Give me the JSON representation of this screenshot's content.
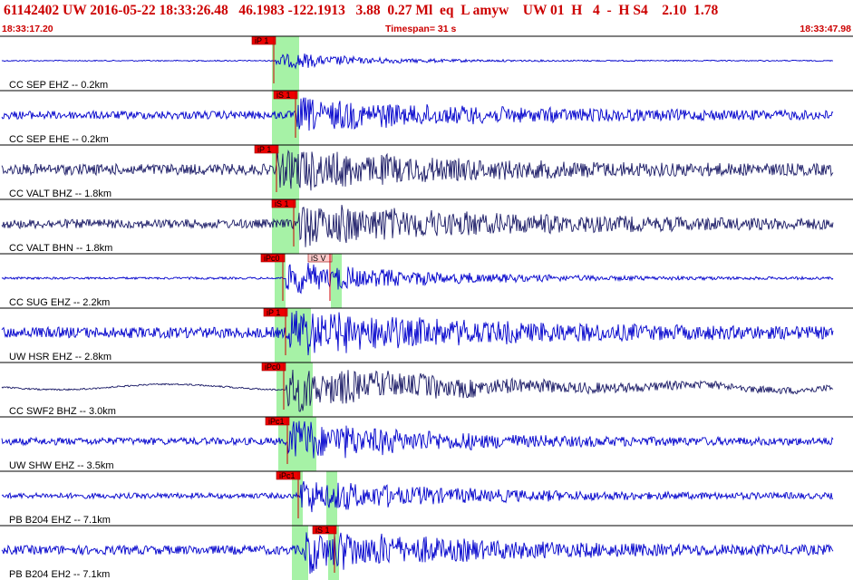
{
  "header": {
    "event_line": "61142402 UW 2016-05-22 18:33:26.48   46.1983 -122.1913   3.88  0.27 Ml  eq  L amyw    UW 01  H   4  -  H S4    2.10  1.78",
    "start_time": "18:33:17.20",
    "timespan": "Timespan=  31 s",
    "end_time": "18:33:47.98"
  },
  "colors": {
    "header_text": "#cc0000",
    "trace_blue": "#0000cc",
    "trace_navy": "#1a1a66",
    "pick_window": "#a6f2a6",
    "pick_flag": "#ee0000",
    "pick_flag_light": "#ffcccc",
    "divider": "#000000"
  },
  "traces": [
    {
      "label": "CC SEP EHZ -- 0.2km",
      "color": "blue",
      "picks": [
        {
          "label": "iP 1",
          "style": "solid"
        }
      ]
    },
    {
      "label": "CC SEP EHE -- 0.2km",
      "color": "blue",
      "picks": [
        {
          "label": "iS 1",
          "style": "solid"
        }
      ]
    },
    {
      "label": "CC VALT BHZ -- 1.8km",
      "color": "navy",
      "picks": [
        {
          "label": "iP 1",
          "style": "solid"
        }
      ]
    },
    {
      "label": "CC VALT BHN -- 1.8km",
      "color": "navy",
      "picks": [
        {
          "label": "iS 1",
          "style": "solid"
        }
      ]
    },
    {
      "label": "CC SUG EHZ -- 2.2km",
      "color": "blue",
      "picks": [
        {
          "label": "iPc0",
          "style": "solid"
        },
        {
          "label": "iS V",
          "style": "light"
        }
      ]
    },
    {
      "label": "UW HSR EHZ -- 2.8km",
      "color": "blue",
      "picks": [
        {
          "label": "iP 1",
          "style": "solid"
        }
      ]
    },
    {
      "label": "CC SWF2 BHZ -- 3.0km",
      "color": "navy",
      "picks": [
        {
          "label": "iPc0",
          "style": "solid"
        }
      ]
    },
    {
      "label": "UW SHW EHZ -- 3.5km",
      "color": "blue",
      "picks": [
        {
          "label": "iPc1",
          "style": "solid"
        }
      ]
    },
    {
      "label": "PB B204 EHZ -- 7.1km",
      "color": "blue",
      "picks": [
        {
          "label": "iPc1",
          "style": "solid"
        }
      ]
    },
    {
      "label": "PB B204 EH2 -- 7.1km",
      "color": "blue",
      "picks": [
        {
          "label": "iS 1",
          "style": "solid"
        }
      ]
    }
  ]
}
